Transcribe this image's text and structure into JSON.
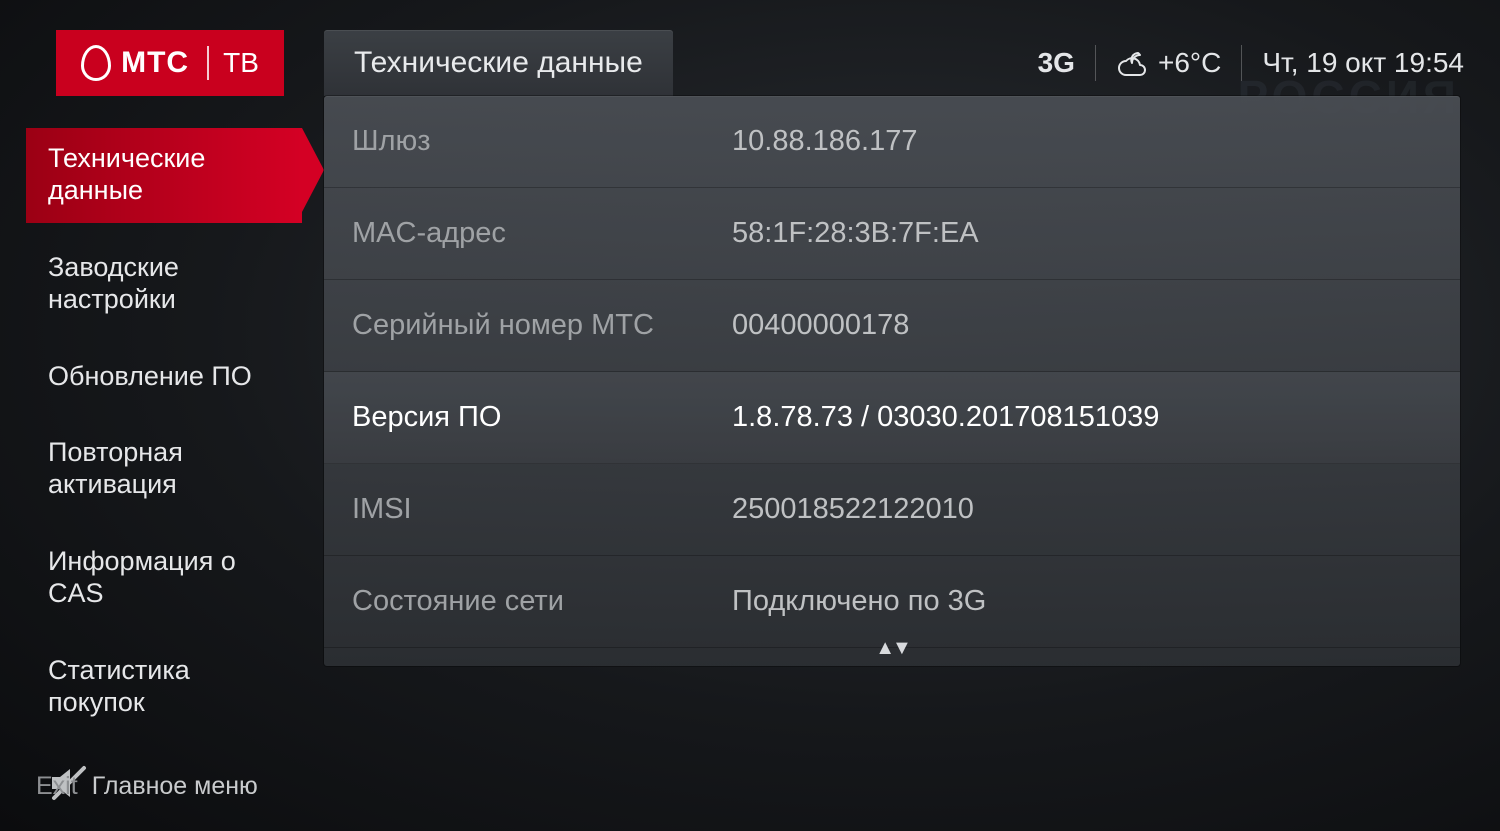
{
  "brand": {
    "name": "МТС",
    "suffix": "ТВ"
  },
  "header": {
    "panel_title": "Технические данные",
    "connection": "3G",
    "temperature": "+6°C",
    "datetime": "Чт, 19 окт 19:54",
    "bg_channel_watermark": "РОССИЯ"
  },
  "sidebar": {
    "items": [
      {
        "label": "Технические данные",
        "active": true
      },
      {
        "label": "Заводские настройки",
        "active": false
      },
      {
        "label": "Обновление ПО",
        "active": false
      },
      {
        "label": "Повторная активация",
        "active": false
      },
      {
        "label": "Информация о CAS",
        "active": false
      },
      {
        "label": "Статистика покупок",
        "active": false
      }
    ]
  },
  "panel": {
    "rows": [
      {
        "label": "Шлюз",
        "value": "10.88.186.177",
        "highlight": false
      },
      {
        "label": "MAC-адрес",
        "value": "58:1F:28:3B:7F:EA",
        "highlight": false
      },
      {
        "label": "Серийный номер МТС",
        "value": "00400000178",
        "highlight": false
      },
      {
        "label": "Версия ПО",
        "value": "1.8.78.73 / 03030.201708151039",
        "highlight": true
      },
      {
        "label": "IMSI",
        "value": "250018522122010",
        "highlight": false
      },
      {
        "label": "Состояние сети",
        "value": "Подключено по 3G",
        "highlight": false
      }
    ]
  },
  "footer": {
    "exit_key": "Exit",
    "exit_label": "Главное меню"
  }
}
